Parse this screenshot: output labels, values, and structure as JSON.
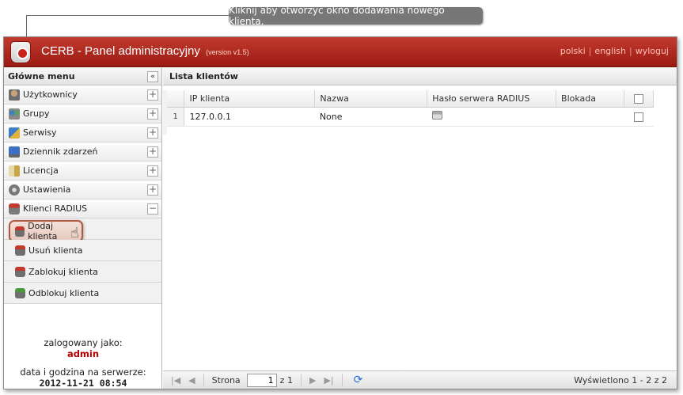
{
  "callout": {
    "text": "Kliknij aby otworzyć okno dodawania nowego klienta."
  },
  "app": {
    "title": "CERB - Panel administracyjny",
    "version": "(version v1.5)",
    "links": [
      "polski",
      "english",
      "wyloguj"
    ],
    "accent": "#b3261e"
  },
  "sidebar": {
    "header": "Główne menu",
    "collapse": "«",
    "items": [
      {
        "label": "Użytkownicy",
        "icon": "users-icon"
      },
      {
        "label": "Grupy",
        "icon": "groups-icon"
      },
      {
        "label": "Serwisy",
        "icon": "services-icon"
      },
      {
        "label": "Dziennik zdarzeń",
        "icon": "log-icon"
      },
      {
        "label": "Licencja",
        "icon": "license-icon"
      },
      {
        "label": "Ustawienia",
        "icon": "settings-icon"
      },
      {
        "label": "Klienci RADIUS",
        "icon": "radius-icon",
        "expanded": true
      }
    ],
    "subitems": [
      {
        "label": "Dodaj klienta",
        "active": true
      },
      {
        "label": "Usuń klienta"
      },
      {
        "label": "Zablokuj klienta"
      },
      {
        "label": "Odblokuj klienta"
      }
    ],
    "login_label": "zalogowany jako:",
    "login_user": "admin",
    "server_label": "data i godzina na serwerze:",
    "server_time": "2012-11-21 08:54"
  },
  "content": {
    "title": "Lista klientów",
    "columns": [
      "IP klienta",
      "Nazwa",
      "Hasło serwera RADIUS",
      "Blokada"
    ],
    "rows": [
      {
        "num": "1",
        "ip": "127.0.0.1",
        "name": "None",
        "password_icon": "password-icon"
      }
    ]
  },
  "pager": {
    "page_label": "Strona",
    "page_value": "1",
    "of_label": "z 1",
    "info": "Wyświetlono 1 - 2 z 2"
  }
}
